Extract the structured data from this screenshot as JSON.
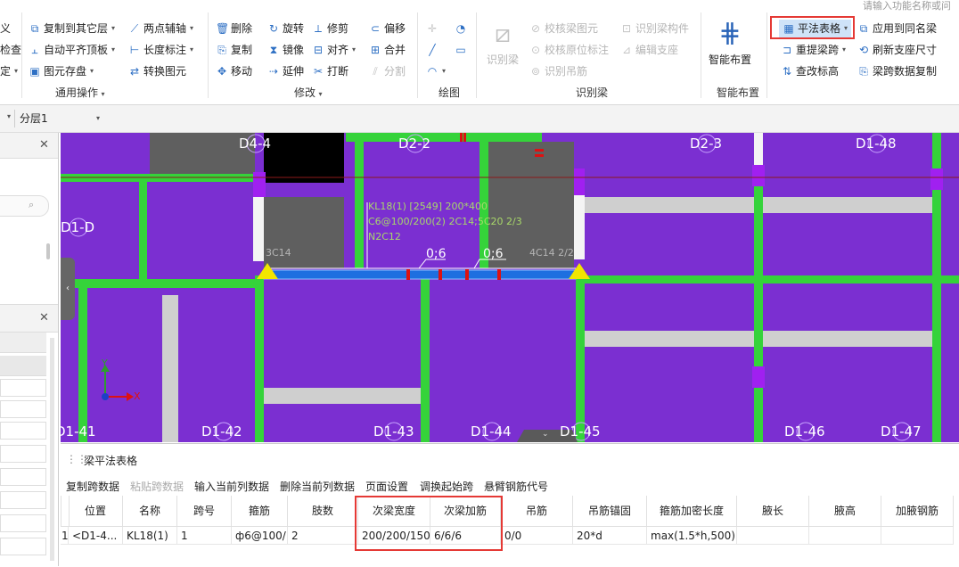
{
  "search_placeholder": "请输入功能名称或问",
  "ribbon": {
    "left_cut": [
      "义",
      "检查",
      "定"
    ],
    "general": [
      "复制到其它层",
      "自动平齐顶板",
      "图元存盘",
      "两点辅轴",
      "长度标注",
      "转换图元"
    ],
    "general_label": "通用操作",
    "modify": [
      "删除",
      "旋转",
      "修剪",
      "偏移",
      "复制",
      "镜像",
      "对齐",
      "合并",
      "移动",
      "延伸",
      "打断",
      "分割"
    ],
    "modify_label": "修改",
    "draw_label": "绘图",
    "identify_big": "识别梁",
    "identify": [
      "校核梁图元",
      "识别梁构件",
      "校核原位标注",
      "编辑支座",
      "识别吊筋"
    ],
    "identify_label": "识别梁",
    "smart_big": "智能布置",
    "smart_label": "智能布置",
    "beam": [
      "平法表格",
      "应用到同名梁",
      "重提梁跨",
      "刷新支座尺寸",
      "查改标高",
      "梁跨数据复制"
    ]
  },
  "layer_select": "分层1",
  "canvas": {
    "axis_labels": [
      "D4-4",
      "D2-2",
      "D2-3",
      "D1-48",
      "D1-D",
      "D1-42",
      "D1-43",
      "D1-44",
      "D1-45",
      "D1-46",
      "D1-47",
      "D1-41"
    ],
    "beam_text_1": "KL18(1) [2549] 200*400",
    "beam_text_2": "C6@100/200(2) 2C14;5C20 2/3",
    "beam_text_3": "N2C12",
    "left_rebar": "3C14",
    "right_rebar": "4C14 2/2",
    "stirrup_a": "0;6",
    "stirrup_b": "0;6",
    "axis_x": "X",
    "axis_y": "Y"
  },
  "table_panel": {
    "title": "梁平法表格",
    "toolbar": [
      "复制跨数据",
      "粘贴跨数据",
      "输入当前列数据",
      "删除当前列数据",
      "页面设置",
      "调换起始跨",
      "悬臂钢筋代号"
    ],
    "headers": [
      "位置",
      "名称",
      "跨号",
      "箍筋",
      "肢数",
      "次梁宽度",
      "次梁加筋",
      "吊筋",
      "吊筋锚固",
      "箍筋加密长度",
      "腋长",
      "腋高",
      "加腋钢筋"
    ],
    "row": {
      "index": "1",
      "cells": [
        "<D1-4...",
        "KL18(1)",
        "1",
        "ф6@100/...",
        "2",
        "200/200/150",
        "6/6/6",
        "0/0",
        "20*d",
        "max(1.5*h,500)",
        "",
        "",
        ""
      ]
    }
  },
  "colors": {
    "purple": "#7b2fd1",
    "green": "#35d33a",
    "gray": "#5f5f5f",
    "highlight": "#e53935",
    "beam_blue": "#1e6fe0"
  }
}
